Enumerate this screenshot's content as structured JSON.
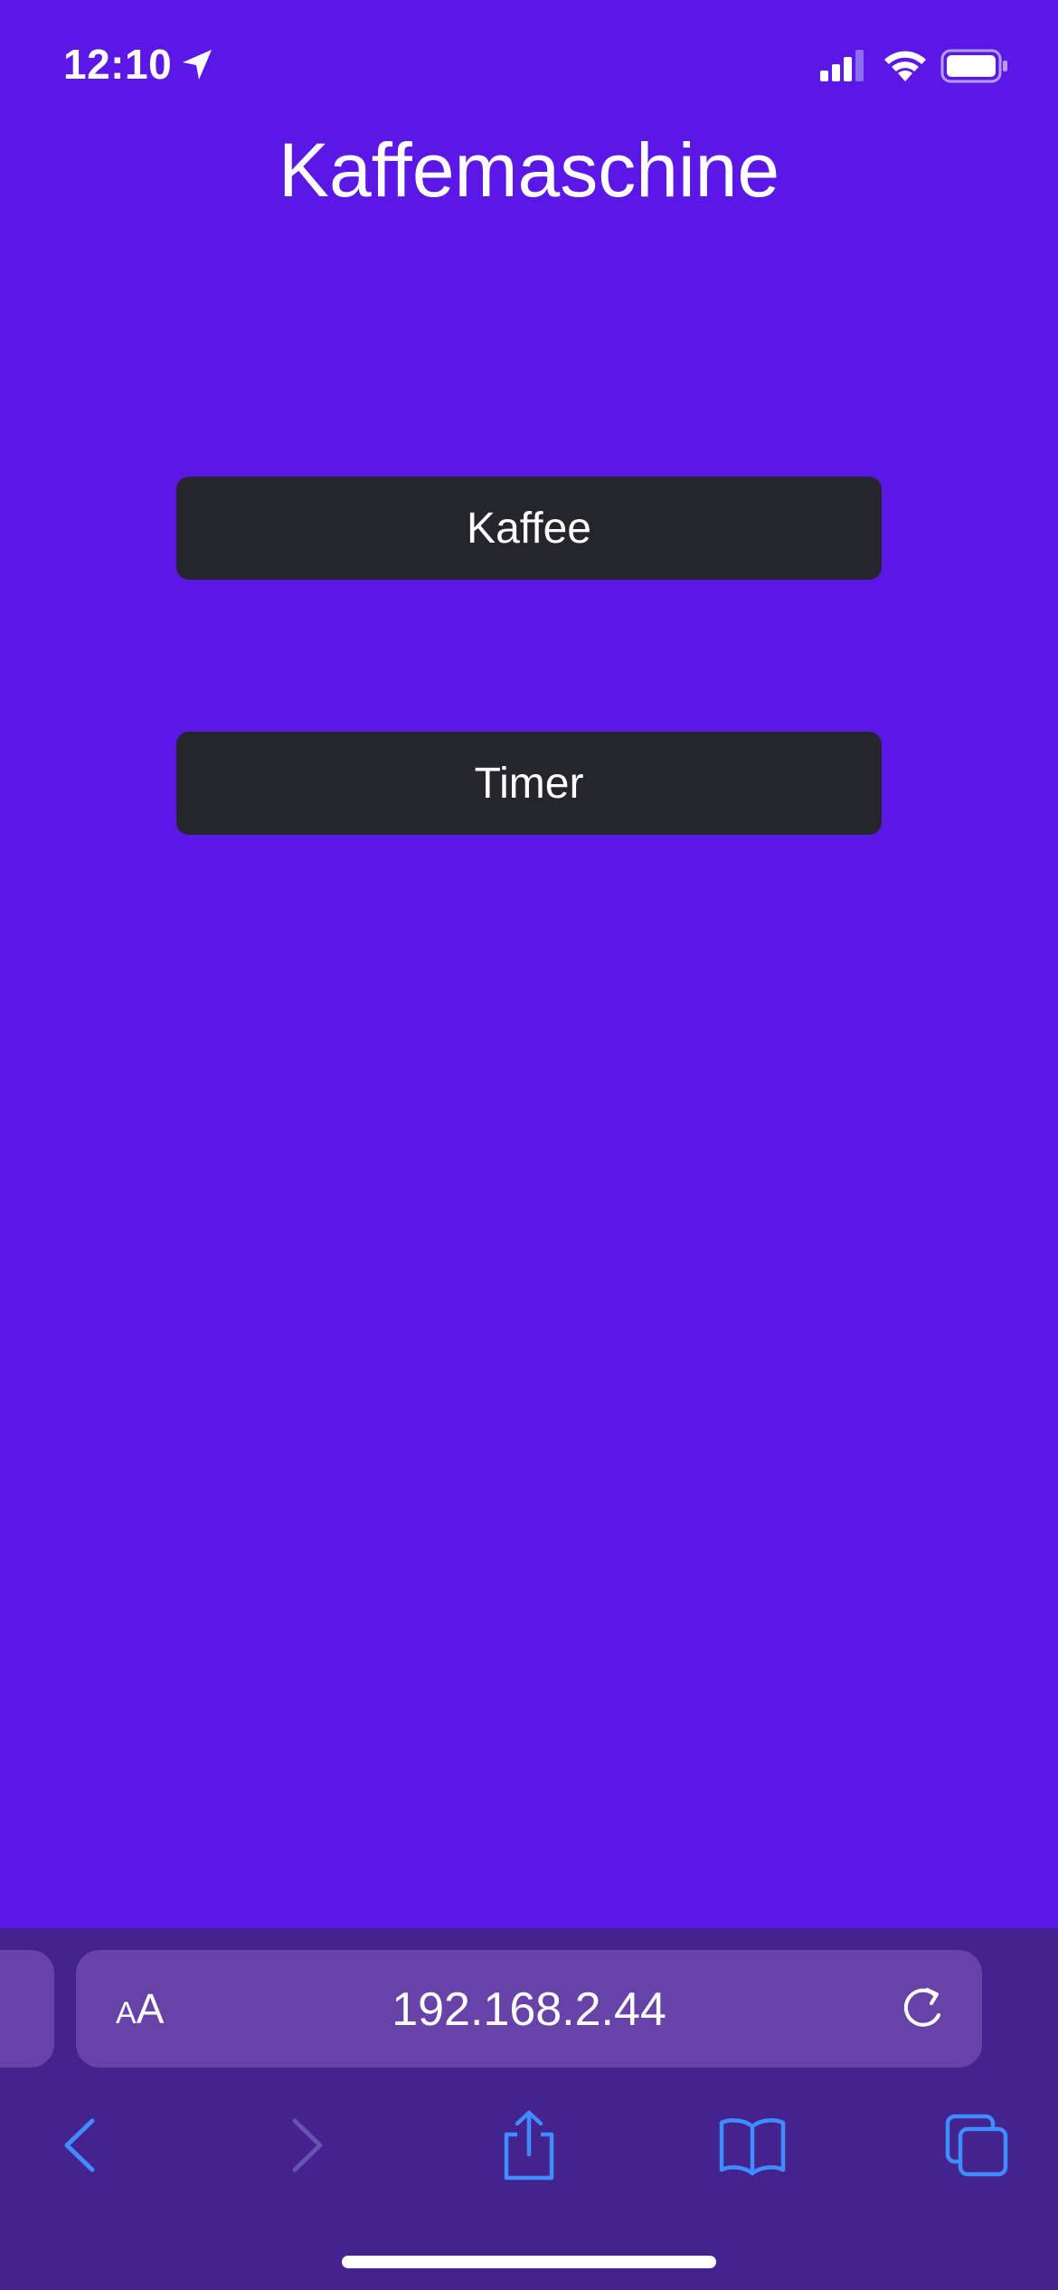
{
  "status_bar": {
    "time": "12:10",
    "location_icon": "location-arrow-icon",
    "signal_icon": "cellular-signal-icon",
    "wifi_icon": "wifi-icon",
    "battery_icon": "battery-icon"
  },
  "page": {
    "title": "Kaffemaschine",
    "background_color": "#5a17e6",
    "buttons": [
      {
        "label": "Kaffee"
      },
      {
        "label": "Timer"
      }
    ],
    "button_color": "#24262b"
  },
  "safari": {
    "text_size_small": "A",
    "text_size_large": "A",
    "url": "192.168.2.44",
    "accent_color": "#3f8cff",
    "toolbar": {
      "back_icon": "chevron-left-icon",
      "forward_icon": "chevron-right-icon",
      "share_icon": "share-icon",
      "bookmarks_icon": "book-icon",
      "tabs_icon": "tabs-icon"
    }
  }
}
